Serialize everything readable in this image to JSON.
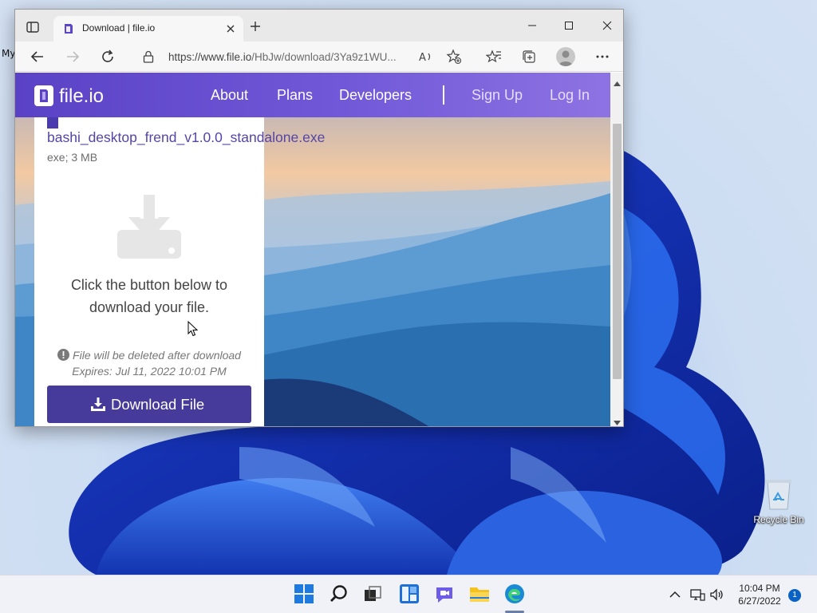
{
  "desktop": {
    "edge_label": "My",
    "recycle_bin_label": "Recycle Bin",
    "recycle_icon": "recycle-bin-icon"
  },
  "browser": {
    "tab_title": "Download | file.io",
    "address": {
      "url_prefix": "https://www.file.io",
      "url_rest": "/HbJw/download/3Ya9z1WU..."
    },
    "icons": [
      "tab-actions-icon",
      "close-icon",
      "new-tab-icon",
      "minimize-icon",
      "maximize-icon",
      "back-icon",
      "forward-icon",
      "refresh-icon",
      "lock-icon",
      "read-aloud-icon",
      "add-favorite-icon",
      "favorites-icon",
      "collections-icon",
      "profile-icon",
      "more-icon"
    ]
  },
  "site": {
    "brand": "file.io",
    "nav": {
      "about": "About",
      "plans": "Plans",
      "developers": "Developers",
      "signup": "Sign Up",
      "login": "Log In"
    },
    "nav_color": "#6a50d2",
    "file": {
      "name": "bashi_desktop_frend_v1.0.0_standalone.exe",
      "meta": "exe; 3 MB"
    },
    "prompt": "Click the button below to download your file.",
    "notice_delete": "File will be deleted after download",
    "notice_expires": "Expires: Jul 11, 2022 10:01 PM",
    "download_button": "Download File",
    "button_color": "#463a9b"
  },
  "taskbar": {
    "apps": [
      "start-icon",
      "search-icon",
      "task-view-icon",
      "widgets-icon",
      "chat-icon",
      "file-explorer-icon",
      "edge-icon"
    ],
    "tray_icons": [
      "chevron-up-icon",
      "network-icon",
      "volume-icon"
    ],
    "time": "10:04 PM",
    "date": "6/27/2022",
    "notification_count": "1"
  }
}
